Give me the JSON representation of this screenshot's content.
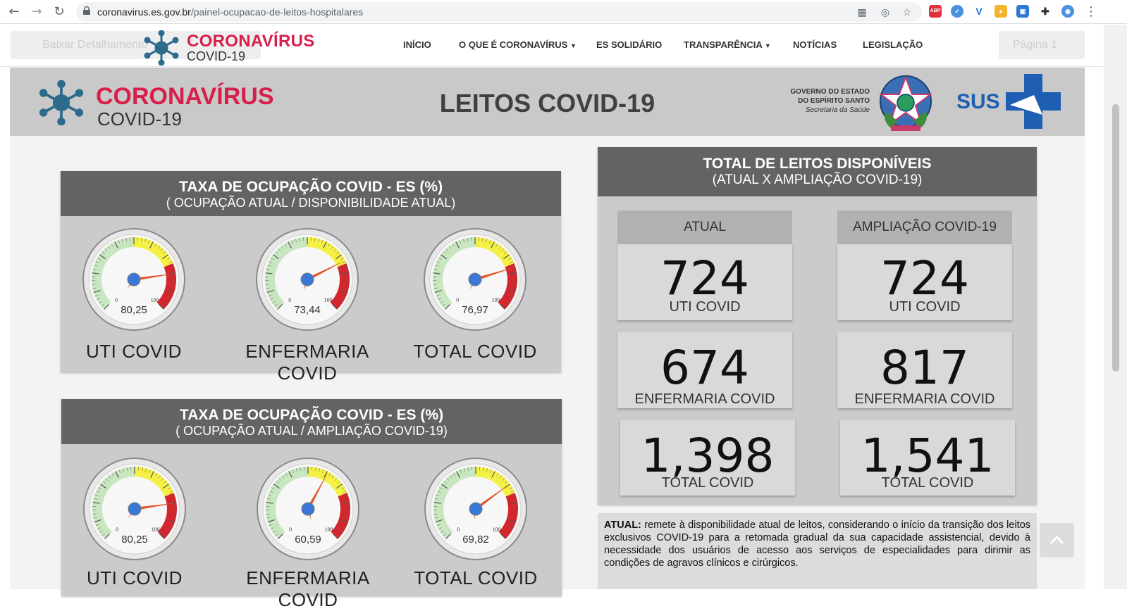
{
  "browser": {
    "url_host": "coronavirus.es.gov.br",
    "url_path": "/painel-ocupacao-de-leitos-hospitalares"
  },
  "header": {
    "download_button": "Baixar Detalhamento",
    "page_button": "Página 1",
    "logo_title": "CORONAVÍRUS",
    "logo_sub": "COVID-19",
    "menu": [
      "INÍCIO",
      "O QUE É CORONAVÍRUS",
      "ES SOLIDÁRIO",
      "TRANSPARÊNCIA",
      "NOTÍCIAS",
      "LEGISLAÇÃO"
    ]
  },
  "banner": {
    "logo_title": "CORONAVÍRUS",
    "logo_sub": "COVID-19",
    "title": "LEITOS COVID-19",
    "gov_line1": "GOVERNO DO ESTADO",
    "gov_line2": "DO ESPÍRITO SANTO",
    "gov_line3": "Secretaria da Saúde",
    "sus": "SUS"
  },
  "occupancy_current": {
    "title": "TAXA DE OCUPAÇÃO COVID - ES (%)",
    "subtitle": "( OCUPAÇÃO ATUAL / DISPONIBILIDADE ATUAL)",
    "gauges": [
      {
        "label": "UTI COVID",
        "value": 80.25,
        "display": "80,25"
      },
      {
        "label": "ENFERMARIA COVID",
        "value": 73.44,
        "display": "73,44"
      },
      {
        "label": "TOTAL COVID",
        "value": 76.97,
        "display": "76,97"
      }
    ]
  },
  "occupancy_expansion": {
    "title": "TAXA DE OCUPAÇÃO COVID - ES (%)",
    "subtitle": "( OCUPAÇÃO ATUAL / AMPLIAÇÃO COVID-19)",
    "gauges": [
      {
        "label": "UTI COVID",
        "value": 80.25,
        "display": "80,25"
      },
      {
        "label": "ENFERMARIA COVID",
        "value": 60.59,
        "display": "60,59"
      },
      {
        "label": "TOTAL COVID",
        "value": 69.82,
        "display": "69,82"
      }
    ]
  },
  "gauge_scale": {
    "min_label": "0",
    "max_label": "100"
  },
  "totals": {
    "title": "TOTAL DE LEITOS DISPONÍVEIS",
    "subtitle": "(ATUAL X AMPLIAÇÃO COVID-19)",
    "columns": [
      {
        "heading": "ATUAL",
        "cards": [
          {
            "value": "724",
            "label": "UTI COVID"
          },
          {
            "value": "674",
            "label": "ENFERMARIA COVID"
          },
          {
            "value": "1,398",
            "label": "TOTAL COVID"
          }
        ]
      },
      {
        "heading": "AMPLIAÇÃO COVID-19",
        "cards": [
          {
            "value": "724",
            "label": "UTI COVID"
          },
          {
            "value": "817",
            "label": "ENFERMARIA COVID"
          },
          {
            "value": "1,541",
            "label": "TOTAL COVID"
          }
        ]
      }
    ]
  },
  "note": {
    "term": "ATUAL:",
    "text": "remete à disponibilidade atual de leitos, considerando o início da transição dos leitos exclusivos COVID-19 para a retomada gradual da sua capacidade assistencial, devido à necessidade dos usuários de acesso aos serviços de especialidades para dirimir as condições de agravos clínicos e cirúrgicos."
  },
  "colors": {
    "brand_red": "#d81e4b",
    "panel_head": "#636363",
    "panel_body": "#cbcbcb",
    "gauge_green": "#c8e6c0",
    "gauge_yellow": "#f5f044",
    "gauge_red": "#d3272d",
    "needle": "#e0552a",
    "hub": "#3a78d8"
  }
}
